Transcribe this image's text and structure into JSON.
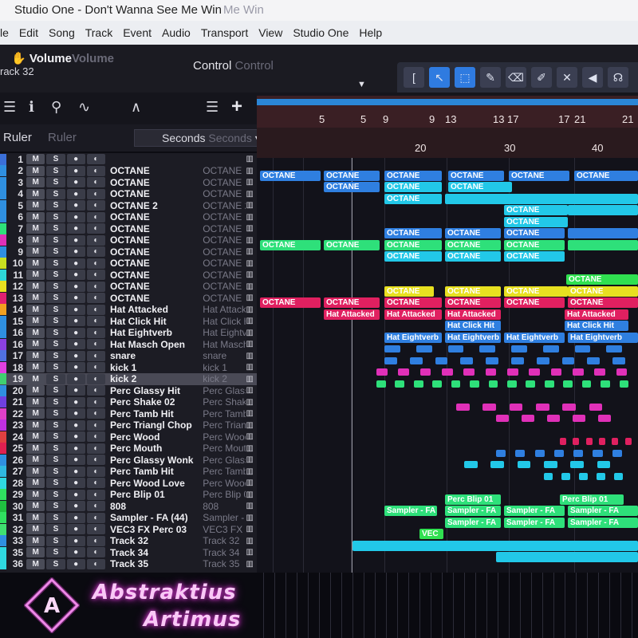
{
  "window": {
    "app": "Studio One",
    "title_sep": " - ",
    "song": "Don't Wanna See Me Win",
    "ghost": "Me Win"
  },
  "menu": [
    "le",
    "Edit",
    "Song",
    "Track",
    "Event",
    "Audio",
    "Transport",
    "View",
    "Studio One",
    "Help"
  ],
  "control_strip": {
    "volume_label": "Volume",
    "volume_ghost": "Volume",
    "track_label": "rack 32",
    "control_label": "Control",
    "control_ghost": "Control"
  },
  "tools": [
    {
      "icon": "bracket-icon",
      "glyph": "["
    },
    {
      "icon": "pointer-icon",
      "glyph": "↖"
    },
    {
      "icon": "range-icon",
      "glyph": "⬚"
    },
    {
      "icon": "pencil-icon",
      "glyph": "✎"
    },
    {
      "icon": "eraser-icon",
      "glyph": "⌫"
    },
    {
      "icon": "paint-icon",
      "glyph": "✐"
    },
    {
      "icon": "mute-tool-icon",
      "glyph": "✕"
    },
    {
      "icon": "speaker-icon",
      "glyph": "◀"
    },
    {
      "icon": "listen-icon",
      "glyph": "☊"
    }
  ],
  "ruler_header": {
    "label": "Ruler",
    "ghost": "Ruler",
    "timebase": "Seconds",
    "timebase_ghost": "Seconds"
  },
  "ruler": {
    "bars": [
      "5",
      "9",
      "13",
      "17",
      "21"
    ],
    "bars_ghost": [
      "5",
      "9",
      "13",
      "17",
      "21"
    ],
    "seconds": [
      "20",
      "30",
      "40"
    ]
  },
  "tracks": [
    {
      "num": "1",
      "name": "",
      "color": "#3b6fd8"
    },
    {
      "num": "2",
      "name": "OCTANE",
      "color": "#2f8fe0"
    },
    {
      "num": "3",
      "name": "OCTANE",
      "color": "#2f8fe0"
    },
    {
      "num": "4",
      "name": "OCTANE",
      "color": "#2f8fe0"
    },
    {
      "num": "5",
      "name": "OCTANE 2",
      "color": "#2f8fe0"
    },
    {
      "num": "6",
      "name": "OCTANE",
      "color": "#2f8fe0"
    },
    {
      "num": "7",
      "name": "OCTANE",
      "color": "#2ee07a"
    },
    {
      "num": "8",
      "name": "OCTANE",
      "color": "#e030b8"
    },
    {
      "num": "9",
      "name": "OCTANE",
      "color": "#2f8fe0"
    },
    {
      "num": "10",
      "name": "OCTANE",
      "color": "#c8e020"
    },
    {
      "num": "11",
      "name": "OCTANE",
      "color": "#2ed8d8"
    },
    {
      "num": "12",
      "name": "OCTANE",
      "color": "#e8e020"
    },
    {
      "num": "13",
      "name": "OCTANE",
      "color": "#e02070"
    },
    {
      "num": "14",
      "name": "Hat Attacked",
      "color": "#f0a020"
    },
    {
      "num": "15",
      "name": "Hat Click Hit",
      "color": "#2f8fe0"
    },
    {
      "num": "16",
      "name": "Hat Eightverb",
      "color": "#2f8fe0"
    },
    {
      "num": "16",
      "name": "Hat Masch Open",
      "color": "#8a40e0"
    },
    {
      "num": "17",
      "name": "snare",
      "color": "#5070e0"
    },
    {
      "num": "18",
      "name": "kick 1",
      "color": "#e040e0"
    },
    {
      "num": "19",
      "name": "kick 2",
      "color": "#40d070"
    },
    {
      "num": "20",
      "name": "Perc Glassy Hit",
      "color": "#2f8fe0"
    },
    {
      "num": "21",
      "name": "Perc Shake 02",
      "color": "#7040e0"
    },
    {
      "num": "22",
      "name": "Perc Tamb Hit",
      "color": "#e040c8"
    },
    {
      "num": "23",
      "name": "Perc Triangl Chop",
      "color": "#c030e0"
    },
    {
      "num": "24",
      "name": "Perc Wood",
      "color": "#e04040"
    },
    {
      "num": "25",
      "name": "Perc Mouth",
      "color": "#e02050"
    },
    {
      "num": "26",
      "name": "Perc Glassy Wonk",
      "color": "#2f8fe0"
    },
    {
      "num": "27",
      "name": "Perc Tamb Hit",
      "color": "#2fb8e0"
    },
    {
      "num": "28",
      "name": "Perc Wood Love",
      "color": "#2fd8e0"
    },
    {
      "num": "29",
      "name": "Perc Blip 01",
      "color": "#30e060"
    },
    {
      "num": "30",
      "name": "808",
      "color": "#20c040"
    },
    {
      "num": "31",
      "name": "Sampler - FA (44)",
      "color": "#30e060"
    },
    {
      "num": "32",
      "name": "VEC3 FX Perc 03",
      "color": "#40e070"
    },
    {
      "num": "33",
      "name": "Track 32",
      "color": "#2f8fe0"
    },
    {
      "num": "35",
      "name": "Track 34",
      "color": "#2fd8e0"
    },
    {
      "num": "36",
      "name": "Track 35",
      "color": "#2fd8e0"
    }
  ],
  "clips": {
    "octane": "OCTANE",
    "hat_attacked": "Hat Attacked",
    "hat_click": "Hat Click Hit",
    "hat_eightverb": "Hat Eightverb",
    "perc_blip": "Perc Blip 01",
    "sampler": "Sampler - FA",
    "vec": "VEC"
  },
  "colors": {
    "blue": "#2f7fe0",
    "cyan": "#22c8e8",
    "green": "#2ee07a",
    "magenta": "#e030b8",
    "yellow": "#e8e020",
    "red": "#e02060",
    "lime": "#30e050"
  },
  "logo": {
    "line1": "Abstraktius",
    "line2": "Artimus"
  }
}
